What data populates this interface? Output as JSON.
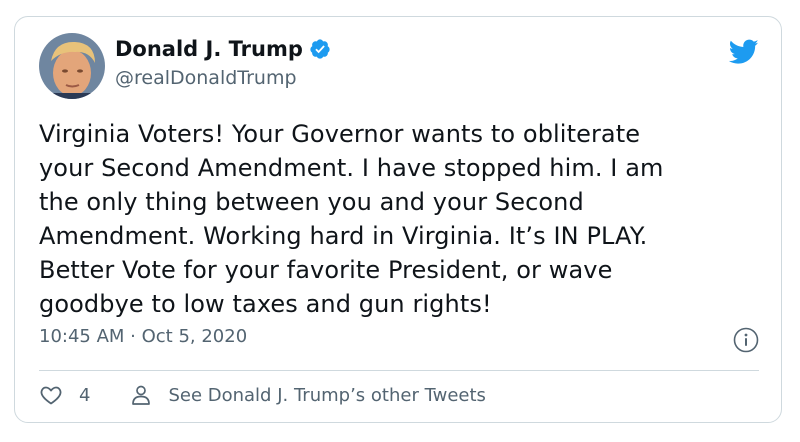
{
  "tweet": {
    "author_name": "Donald J. Trump",
    "handle": "@realDonaldTrump",
    "verified": true,
    "text": "Virginia Voters! Your Governor wants to obliterate\nyour Second Amendment. I have stopped him. I am\nthe only thing between you and your Second\nAmendment. Working hard in Virginia. It’s IN PLAY.\nBetter Vote for your favorite President, or wave\ngoodbye to low taxes and gun rights!",
    "timestamp": "10:45 AM · Oct 5, 2020",
    "like_count": "4",
    "other_tweets_label": "See Donald J. Trump’s other Tweets"
  },
  "icons": {
    "verified": "verified-badge-icon",
    "brand": "twitter-bird-icon",
    "info": "info-icon",
    "like": "heart-icon",
    "profile": "person-icon"
  },
  "colors": {
    "brand": "#1d9bf0",
    "text": "#0f1419",
    "secondary": "#536471",
    "border": "#cfd9de"
  }
}
